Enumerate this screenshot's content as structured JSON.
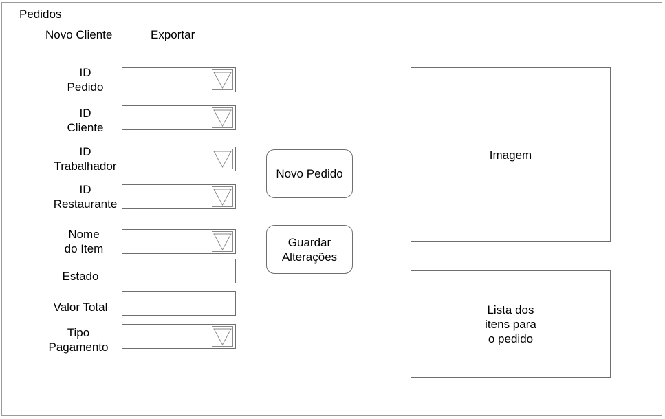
{
  "window": {
    "title": "Pedidos"
  },
  "menu": {
    "new_client": "Novo Cliente",
    "export": "Exportar"
  },
  "form": {
    "id_pedido": {
      "label": "ID\nPedido"
    },
    "id_cliente": {
      "label": "ID\nCliente"
    },
    "id_trabalhador": {
      "label": "ID\nTrabalhador"
    },
    "id_restaurante": {
      "label": "ID\nRestaurante"
    },
    "nome_item": {
      "label": "Nome\ndo Item"
    },
    "estado": {
      "label": "Estado",
      "value": ""
    },
    "valor_total": {
      "label": "Valor Total",
      "value": ""
    },
    "tipo_pagamento": {
      "label": "Tipo\nPagamento"
    }
  },
  "buttons": {
    "new_order": "Novo Pedido",
    "save_changes": "Guardar\nAlterações"
  },
  "panels": {
    "image": "Imagem",
    "items_list": "Lista dos\nitens para\no pedido"
  },
  "icons": {
    "dropdown": "chevron-down-icon"
  }
}
